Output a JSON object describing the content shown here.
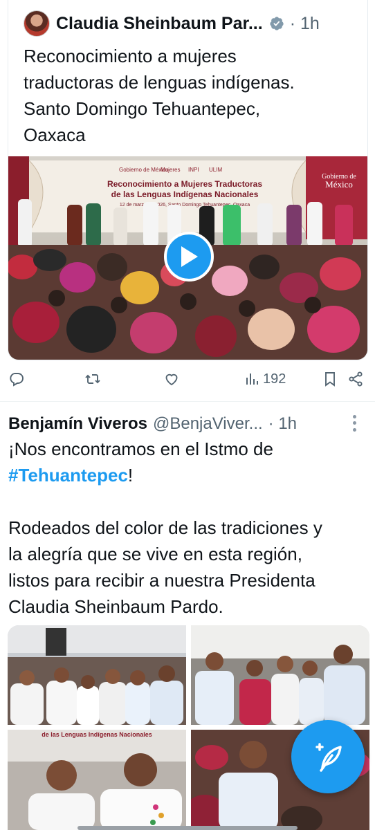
{
  "quoted_tweet": {
    "author_name": "Claudia Sheinbaum Par...",
    "time": "· 1h",
    "text_lines": [
      "Reconocimiento a mujeres",
      "traductoras de lenguas indígenas.",
      "Santo Domingo Tehuantepec,",
      "Oaxaca"
    ],
    "media": {
      "banner_logos": [
        "Gobierno de México",
        "Mujeres",
        "INPI",
        "ULIM"
      ],
      "banner_title_1": "Reconocimiento a Mujeres Traductoras",
      "banner_title_2": "de las Lenguas Indígenas Nacionales",
      "banner_sub": "12 de marzo de 2026, Santo Domingo Tehuantepec, Oaxaca",
      "gov_label_1": "Gobierno de",
      "gov_label_2": "México"
    }
  },
  "actions": {
    "views": "192"
  },
  "tweet2": {
    "author_name": "Benjamín Viveros",
    "handle": "@BenjaViver...",
    "time": "· 1h",
    "line1": "¡Nos encontramos en el Istmo de",
    "hashtag": "#Tehuantepec",
    "hashtag_suffix": "!",
    "para2": [
      "Rodeados del color de las tradiciones y",
      "la alegría que se vive en esta región,",
      "listos para recibir a nuestra Presidenta",
      "Claudia Sheinbaum Pardo."
    ],
    "photo3_banner": "de las Lenguas Indígenas Nacionales"
  },
  "colors": {
    "accent": "#1d9bf0",
    "text": "#0f1419",
    "muted": "#536471"
  },
  "icons": [
    "reply-icon",
    "retweet-icon",
    "like-icon",
    "views-icon",
    "bookmark-icon",
    "share-icon",
    "verified-icon",
    "play-icon",
    "compose-icon",
    "more-icon"
  ]
}
